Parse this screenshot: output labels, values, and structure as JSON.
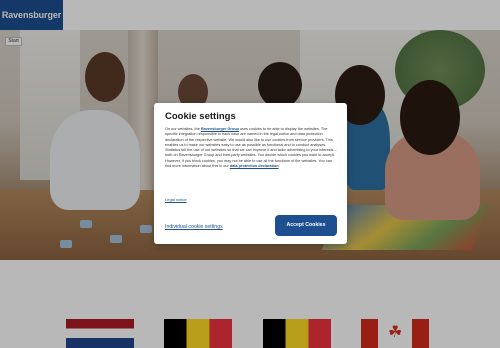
{
  "header": {
    "logo_text": "Ravensburger"
  },
  "hero": {
    "start_label": "Start"
  },
  "cookie_dialog": {
    "title": "Cookie settings",
    "body_before_link": "On our websites, the ",
    "body_link": "Ravensburger Group",
    "body_middle": " uses cookies to be able to display the websites. The specific integration responsible in each case are named in the legal notice and data protection declaration of the respective website. We would also like to use cookies from service providers. This enables us to make our websites easy to use as possible as functional and to conduct analyses. Statistics tell the use of our websites so that we can improve it and tailor advertising to your interests – both on Ravensburger Group and third-party websites. You decide which cookies you want to accept. However, if you block cookies, you may not be able to use all the functions of the websites. You can find more information about this in our ",
    "body_link2": "data protection declaration",
    "body_end": ".",
    "legal_notice": "Legal notice",
    "individual_settings": "Individual cookie settings",
    "accept_label": "Accept Cookies"
  },
  "flags": [
    "netherlands-flag",
    "belgium-flag",
    "germany-flag",
    "canada-flag"
  ],
  "colors": {
    "brand": "#1d4f91",
    "overlay": "rgba(0,0,0,0.28)"
  }
}
